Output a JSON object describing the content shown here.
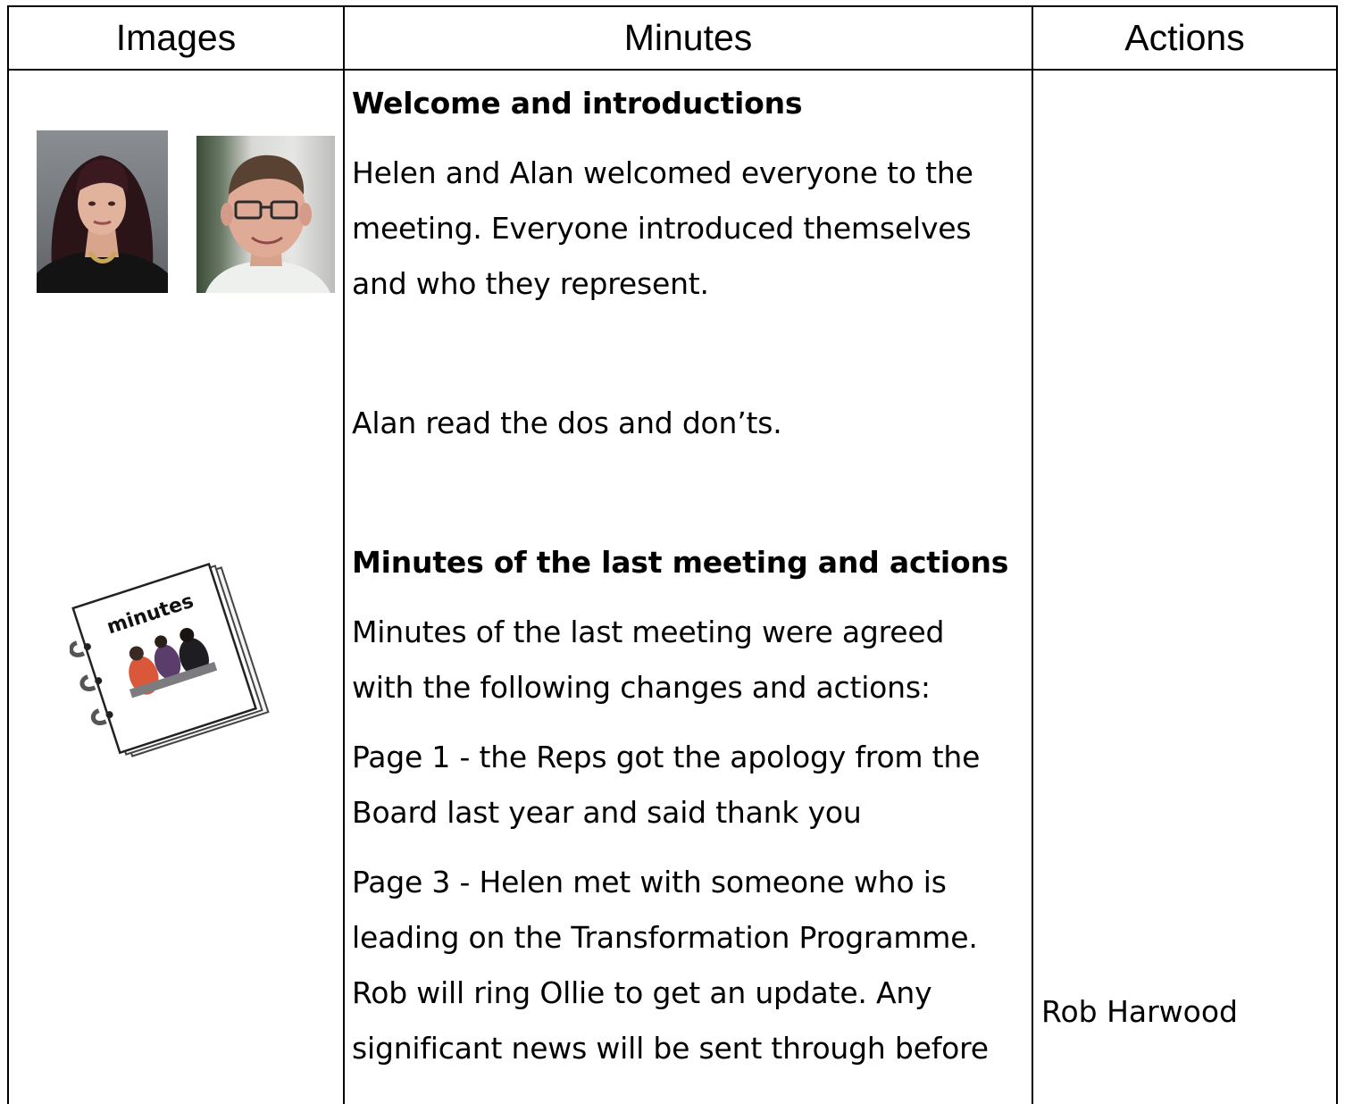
{
  "header": {
    "images": "Images",
    "minutes": "Minutes",
    "actions": "Actions"
  },
  "section1": {
    "heading": "Welcome and introductions",
    "lines": [
      "Helen and Alan welcomed everyone to the",
      "meeting. Everyone introduced themselves",
      "and who they represent.",
      "Alan read the dos and don’ts."
    ]
  },
  "section2": {
    "heading": "Minutes of the last meeting and actions",
    "lines": [
      "Minutes of the last meeting were agreed",
      "with the following changes and actions:",
      "Page 1 - the Reps got the apology from the",
      "Board last year and said thank you",
      "Page 3 - Helen met with someone who is",
      "leading on the Transformation Programme.",
      "Rob will ring Ollie to get an update. Any",
      "significant news will be sent through before"
    ]
  },
  "actions": {
    "rob": "Rob Harwood"
  },
  "images": {
    "clipart_label": "minutes"
  }
}
